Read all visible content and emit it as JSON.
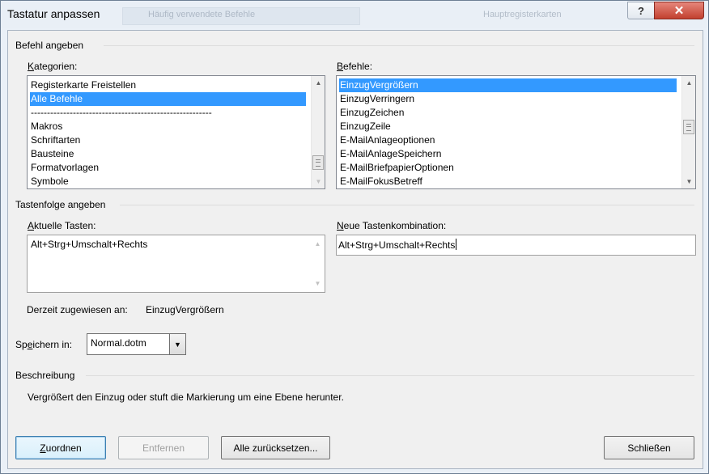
{
  "window": {
    "title": "Tastatur anpassen",
    "help_label": "?",
    "close_label": "✕",
    "background_text_left": "Häufig verwendete Befehle",
    "background_text_right": "Hauptregisterkarten"
  },
  "sections": {
    "command": "Befehl angeben",
    "keys": "Tastenfolge angeben",
    "description": "Beschreibung"
  },
  "categories": {
    "label": "Kategorien:",
    "items": [
      "Registerkarte Freistellen",
      "Alle Befehle",
      "--------------------------------------------------------",
      "Makros",
      "Schriftarten",
      "Bausteine",
      "Formatvorlagen",
      "Symbole"
    ],
    "selected_index": 1
  },
  "commands": {
    "label": "Befehle:",
    "items": [
      "EinzugVergrößern",
      "EinzugVerringern",
      "EinzugZeichen",
      "EinzugZeile",
      "E-MailAnlageoptionen",
      "E-MailAnlageSpeichern",
      "E-MailBriefpapierOptionen",
      "E-MailFokusBetreff"
    ],
    "selected_index": 0
  },
  "current_keys": {
    "label": "Aktuelle Tasten:",
    "value": "Alt+Strg+Umschalt+Rechts"
  },
  "new_key": {
    "label": "Neue Tastenkombination:",
    "value": "Alt+Strg+Umschalt+Rechts"
  },
  "assigned": {
    "label": "Derzeit zugewiesen an:",
    "value": "EinzugVergrößern"
  },
  "save_in": {
    "label": "Speichern in:",
    "value": "Normal.dotm"
  },
  "description_text": "Vergrößert den Einzug oder stuft die Markierung um eine Ebene herunter.",
  "buttons": {
    "assign": "Zuordnen",
    "remove": "Entfernen",
    "reset_all": "Alle zurücksetzen...",
    "close": "Schließen"
  },
  "colors": {
    "selection": "#3399ff",
    "close_button": "#c2402f"
  }
}
